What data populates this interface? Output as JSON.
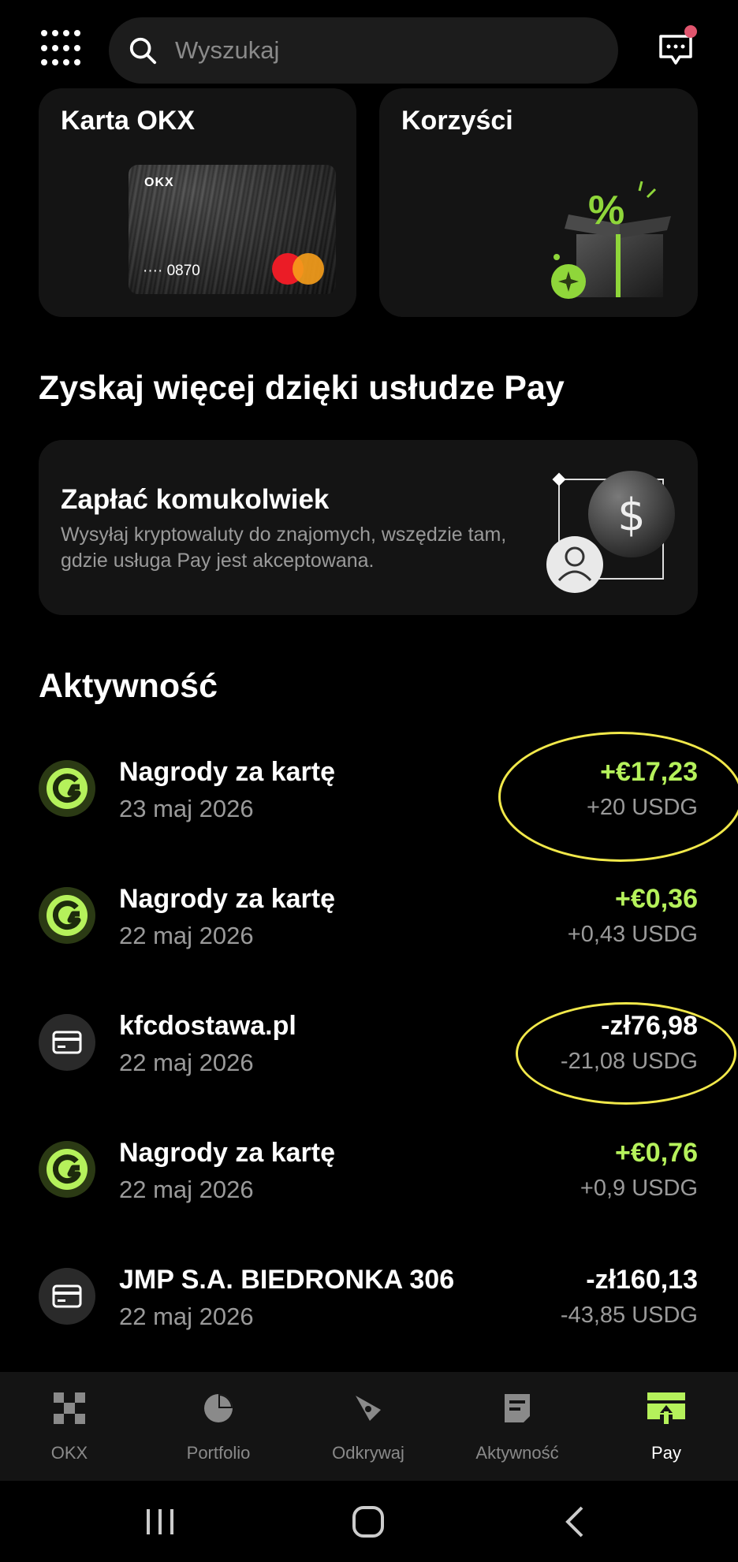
{
  "header": {
    "search_placeholder": "Wyszukaj",
    "icons": [
      "apps-grid-icon",
      "search-icon",
      "chat-icon"
    ]
  },
  "top_cards": {
    "card": {
      "title": "Karta OKX",
      "card_brand": "OKX",
      "card_number": "···· 0870"
    },
    "benefits": {
      "title": "Korzyści"
    }
  },
  "pay_section": {
    "heading": "Zyskaj więcej dzięki usłudze Pay",
    "promo": {
      "title": "Zapłać komukolwiek",
      "description": "Wysyłaj kryptowaluty do znajomych, wszędzie tam, gdzie usługa Pay jest akceptowana."
    }
  },
  "activity": {
    "heading": "Aktywność",
    "items": [
      {
        "name": "Nagrody za kartę",
        "date": "23 maj 2026",
        "amount": "+€17,23",
        "sub": "+20 USDG",
        "type": "reward"
      },
      {
        "name": "Nagrody za kartę",
        "date": "22 maj 2026",
        "amount": "+€0,36",
        "sub": "+0,43 USDG",
        "type": "reward"
      },
      {
        "name": "kfcdostawa.pl",
        "date": "22 maj 2026",
        "amount": "-zł76,98",
        "sub": "-21,08 USDG",
        "type": "card"
      },
      {
        "name": "Nagrody za kartę",
        "date": "22 maj 2026",
        "amount": "+€0,76",
        "sub": "+0,9 USDG",
        "type": "reward"
      },
      {
        "name": "JMP S.A. BIEDRONKA 306",
        "date": "22 maj 2026",
        "amount": "-zł160,13",
        "sub": "-43,85 USDG",
        "type": "card"
      }
    ]
  },
  "bottom_nav": {
    "items": [
      {
        "label": "OKX",
        "icon": "okx-logo-icon"
      },
      {
        "label": "Portfolio",
        "icon": "pie-chart-icon"
      },
      {
        "label": "Odkrywaj",
        "icon": "compass-icon"
      },
      {
        "label": "Aktywność",
        "icon": "receipt-icon"
      },
      {
        "label": "Pay",
        "icon": "pay-icon"
      }
    ],
    "active": "Pay"
  },
  "colors": {
    "background": "#000000",
    "card_bg": "#141414",
    "accent_green": "#b5f15b",
    "muted_text": "#9a9a9a",
    "annotation": "#f1e84a"
  }
}
